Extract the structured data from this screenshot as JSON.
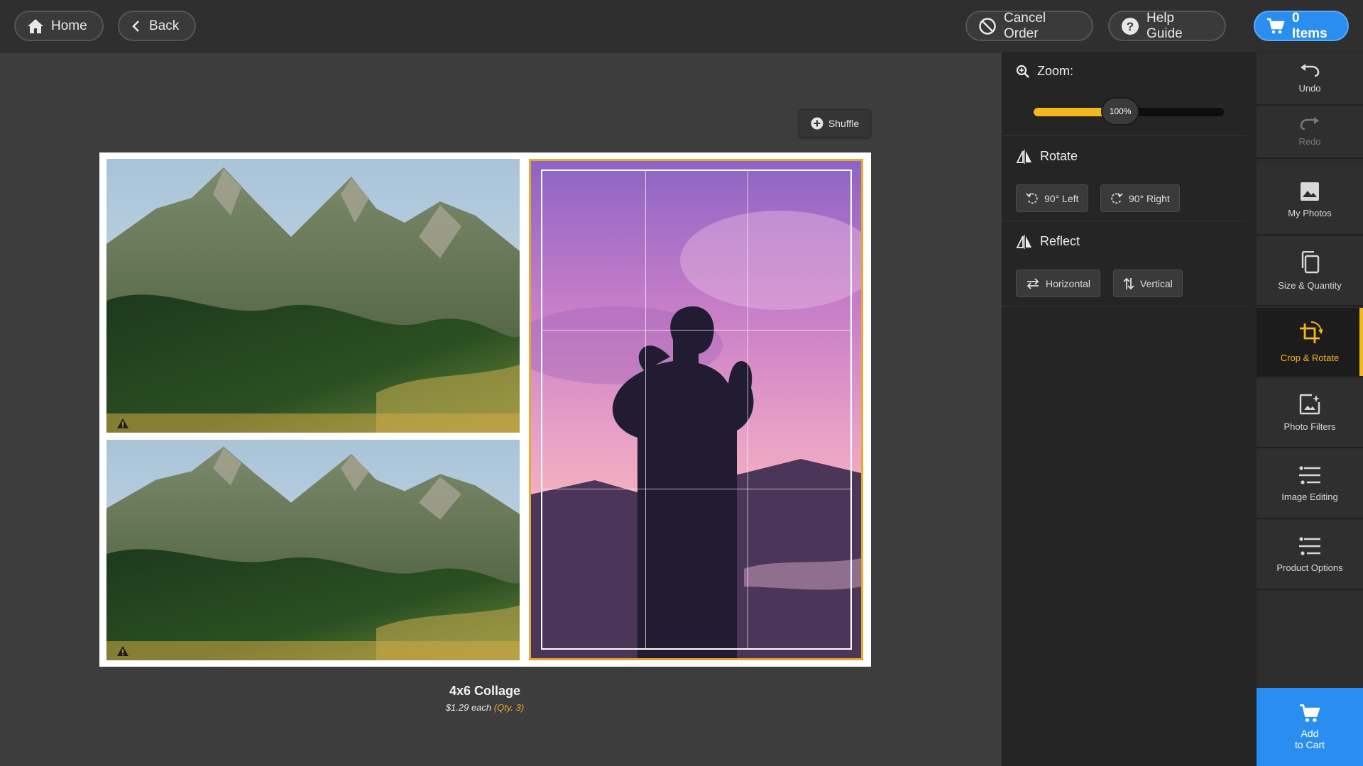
{
  "nav": {
    "home_label": "Home",
    "back_label": "Back",
    "cancel_label": "Cancel Order",
    "help_label": "Help Guide",
    "cart_label": "0 Items"
  },
  "canvas": {
    "shuffle_label": "Shuffle",
    "photos": [
      {
        "subject": "mountain landscape",
        "low_resolution_warning": true
      },
      {
        "subject": "mountain landscape",
        "low_resolution_warning": true
      },
      {
        "subject": "person at sunset",
        "selected": true
      }
    ],
    "product": {
      "title": "4x6 Collage",
      "price": "$1.29 each",
      "qty": "(Qty. 3)"
    }
  },
  "panel": {
    "zoom": {
      "label": "Zoom:",
      "value_text": "100%",
      "fill_fraction": 0.4
    },
    "rotate": {
      "label": "Rotate",
      "left_label": "90° Left",
      "right_label": "90° Right"
    },
    "reflect": {
      "label": "Reflect",
      "horizontal_label": "Horizontal",
      "vertical_label": "Vertical"
    }
  },
  "rail": {
    "undo": "Undo",
    "redo": "Redo",
    "my_photos": "My Photos",
    "size_quantity": "Size & Quantity",
    "crop_rotate": "Crop & Rotate",
    "photo_filters": "Photo Filters",
    "image_editing": "Image Editing",
    "product_options": "Product Options",
    "add_to_cart_1": "Add",
    "add_to_cart_2": "to Cart"
  },
  "colors": {
    "accent": "#f2b81e",
    "primary": "#2a8ef0",
    "selection_border": "#e4ac2c"
  },
  "icons": [
    "home-icon",
    "chevron-left-icon",
    "ban-icon",
    "help-icon",
    "cart-icon",
    "plus-circle-icon",
    "warning-icon",
    "zoom-icon",
    "flip-icon",
    "rotate-left-icon",
    "rotate-right-icon",
    "swap-horizontal-icon",
    "swap-vertical-icon",
    "undo-icon",
    "redo-icon",
    "image-icon",
    "copy-icon",
    "crop-icon",
    "sparkle-image-icon",
    "sliders-icon"
  ]
}
